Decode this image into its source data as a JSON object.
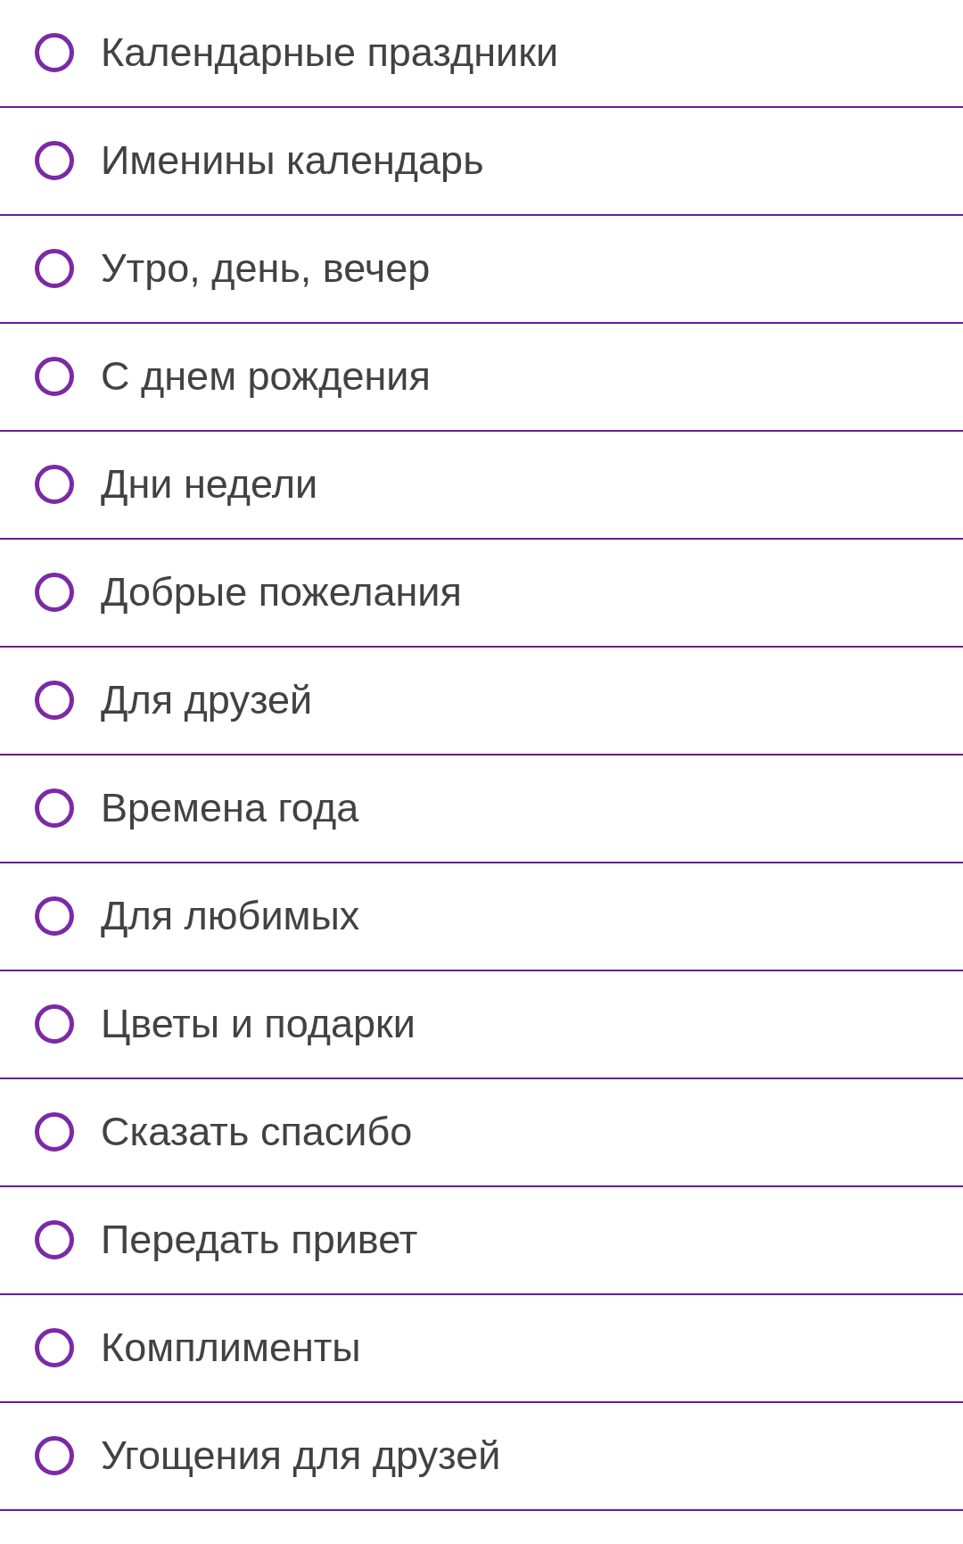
{
  "options": [
    {
      "label": "Календарные праздники",
      "selected": false
    },
    {
      "label": "Именины календарь",
      "selected": false
    },
    {
      "label": "Утро, день, вечер",
      "selected": false
    },
    {
      "label": "С днем рождения",
      "selected": false
    },
    {
      "label": "Дни недели",
      "selected": false
    },
    {
      "label": "Добрые пожелания",
      "selected": false
    },
    {
      "label": "Для друзей",
      "selected": false
    },
    {
      "label": "Времена года",
      "selected": false
    },
    {
      "label": "Для любимых",
      "selected": false
    },
    {
      "label": "Цветы и подарки",
      "selected": false
    },
    {
      "label": "Сказать спасибо",
      "selected": false
    },
    {
      "label": "Передать привет",
      "selected": false
    },
    {
      "label": "Комплименты",
      "selected": false
    },
    {
      "label": "Угощения для друзей",
      "selected": false
    }
  ]
}
